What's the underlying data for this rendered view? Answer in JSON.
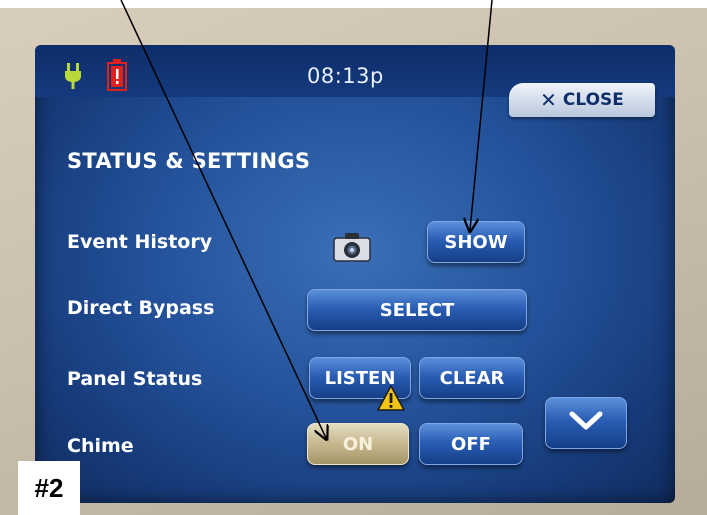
{
  "status_bar": {
    "time": "08:13p",
    "power_icon": "plug-icon",
    "battery_icon": "battery-alert-icon",
    "close_label": "CLOSE"
  },
  "title": "STATUS & SETTINGS",
  "rows": {
    "event_history": {
      "label": "Event History",
      "button": "SHOW",
      "icon": "camera-icon"
    },
    "direct_bypass": {
      "label": "Direct Bypass",
      "button": "SELECT"
    },
    "panel_status": {
      "label": "Panel Status",
      "listen": "LISTEN",
      "clear": "CLEAR",
      "icon": "warning-icon"
    },
    "chime": {
      "label": "Chime",
      "on": "ON",
      "off": "OFF",
      "selected": "ON"
    }
  },
  "scroll_down_icon": "chevron-down-icon",
  "annotation_tag": "#2",
  "colors": {
    "screen_blue": "#24529a",
    "button_blue": "#2a5eb5",
    "selected_gold": "#c3b48a",
    "plug_green": "#b9d83a",
    "battery_red": "#e0201a"
  }
}
